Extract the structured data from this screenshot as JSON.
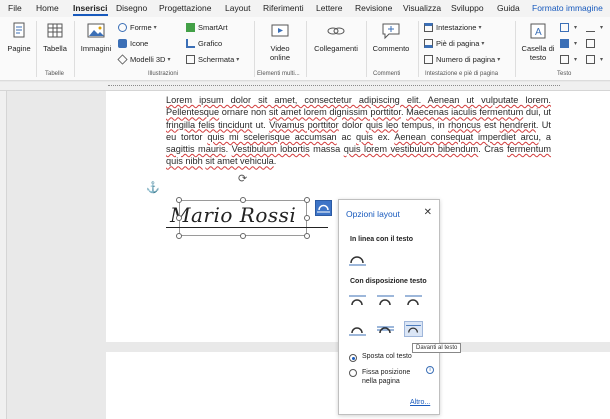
{
  "tabs": [
    "File",
    "Home",
    "Inserisci",
    "Disegno",
    "Progettazione",
    "Layout",
    "Riferimenti",
    "Lettere",
    "Revisione",
    "Visualizza",
    "Sviluppo",
    "Guida",
    "Formato immagine"
  ],
  "ribbon": {
    "pages": "Pagine",
    "table": "Tabella",
    "table_group": "Tabelle",
    "images": "Immagini",
    "shapes": "Forme",
    "icons": "Icone",
    "models3d": "Modelli 3D",
    "smartart": "SmartArt",
    "chart": "Grafico",
    "screenshot": "Schermata",
    "illustrations_group": "Illustrazioni",
    "video": "Video online",
    "media_group": "Elementi multi...",
    "links": "Collegamenti",
    "comment": "Commento",
    "comments_group": "Commenti",
    "header": "Intestazione",
    "footer": "Piè di pagina",
    "page_number": "Numero di pagina",
    "hf_group": "Intestazione e piè di pagina",
    "textbox": "Casella di testo",
    "text_group": "Testo"
  },
  "document": {
    "segments": [
      {
        "t": "Lorem ipsum dolor sit amet, consectetur adipiscing elit. Aenean ut vulputate lorem. Pellentesque",
        "err": true
      },
      {
        "t": " ornare non ",
        "err": false
      },
      {
        "t": "sit amet lorem dignissim porttitor",
        "err": true
      },
      {
        "t": ". ",
        "err": false
      },
      {
        "t": "Maecenas iaculis fermentum",
        "err": true
      },
      {
        "t": " dui, ut ",
        "err": false
      },
      {
        "t": "fringilla felis tincidunt",
        "err": true
      },
      {
        "t": " ut. ",
        "err": false
      },
      {
        "t": "Vivamus porttitor",
        "err": true
      },
      {
        "t": " dolor ",
        "err": false
      },
      {
        "t": "quis leo",
        "err": true
      },
      {
        "t": " tempus, in ",
        "err": false
      },
      {
        "t": "rhoncus",
        "err": true
      },
      {
        "t": " est ",
        "err": false
      },
      {
        "t": "hendrerit",
        "err": true
      },
      {
        "t": ". Ut eu tortor ",
        "err": false
      },
      {
        "t": "quis mi scelerisque accumsan",
        "err": true
      },
      {
        "t": " ac ",
        "err": false
      },
      {
        "t": "quis",
        "err": true
      },
      {
        "t": " ex. ",
        "err": false
      },
      {
        "t": "Aenean consequat imperdiet arcu",
        "err": true
      },
      {
        "t": ", a ",
        "err": false
      },
      {
        "t": "sagittis mauris",
        "err": true
      },
      {
        "t": ". ",
        "err": false
      },
      {
        "t": "Vestibulum lobortis",
        "err": true
      },
      {
        "t": " massa ",
        "err": false
      },
      {
        "t": "quis lorem vestibulum bibendum",
        "err": true
      },
      {
        "t": ". Cras ",
        "err": false
      },
      {
        "t": "fermentum quis nibh",
        "err": true
      },
      {
        "t": " ",
        "err": false
      },
      {
        "t": "sit amet vehicula",
        "err": true
      },
      {
        "t": ".",
        "err": false
      }
    ],
    "signature": "Mario Rossi"
  },
  "layout_pane": {
    "title": "Opzioni layout",
    "inline_heading": "In linea con il testo",
    "wrap_heading": "Con disposizione testo",
    "move_with_text": "Sposta col testo",
    "fix_position": "Fissa posizione nella pagina",
    "more": "Altro...",
    "tooltip": "Davanti al testo"
  },
  "colors": {
    "accent": "#185abd",
    "spell_error": "#d23b3b"
  }
}
